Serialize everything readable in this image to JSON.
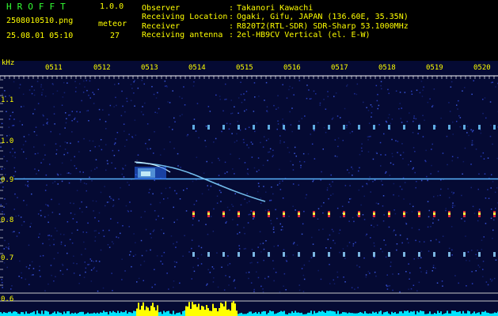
{
  "header": {
    "app_name": "HROFFT",
    "version": "1.0.0",
    "filename": "2508010510.png",
    "timestamp": "25.08.01 05:10",
    "meteor_label": "meteor",
    "meteor_count": "27",
    "info": [
      {
        "label": "Observer",
        "value": "Takanori Kawachi"
      },
      {
        "label": "Receiving Location",
        "value": "Ogaki, Gifu, JAPAN (136.60E, 35.35N)"
      },
      {
        "label": "Receiver",
        "value": "R820T2(RTL-SDR) SDR-Sharp 53.1000MHz"
      },
      {
        "label": "Receiving antenna",
        "value": "2el-HB9CV Vertical (el. E-W)"
      }
    ],
    "separator": ":"
  },
  "spectrogram": {
    "y_unit": "kHz",
    "y_ticks": [
      "1.1",
      "1.0",
      "0.9",
      "0.8",
      "0.7",
      "0.6"
    ],
    "x_ticks": [
      "0511",
      "0512",
      "0513",
      "0514",
      "0515",
      "0516",
      "0517",
      "0518",
      "0519",
      "0520"
    ],
    "colors": {
      "background": "#050a33",
      "carrier": "#5ab4ff",
      "label": "#ffff00",
      "tick": "#ffffff",
      "baseline_fill": "#00e5ff",
      "burst": "#ffff00"
    }
  }
}
